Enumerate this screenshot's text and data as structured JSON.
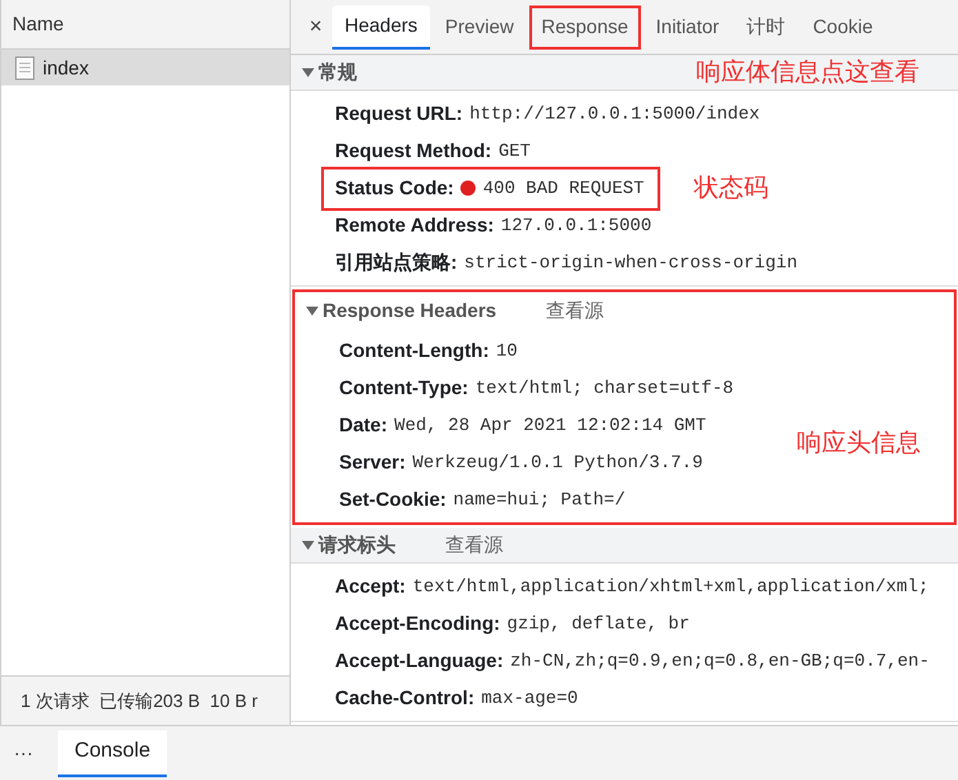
{
  "request_list": {
    "header": "Name",
    "items": [
      {
        "name": "index",
        "selected": true
      }
    ],
    "status_bar": "1 次请求  已传输203 B  10 B r"
  },
  "tabs": {
    "close": "×",
    "items": [
      {
        "label": "Headers",
        "selected": true,
        "highlighted": false
      },
      {
        "label": "Preview",
        "selected": false,
        "highlighted": false
      },
      {
        "label": "Response",
        "selected": false,
        "highlighted": true
      },
      {
        "label": "Initiator",
        "selected": false,
        "highlighted": false
      },
      {
        "label": "计时",
        "selected": false,
        "highlighted": false
      },
      {
        "label": "Cookie",
        "selected": false,
        "highlighted": false
      }
    ]
  },
  "sections": [
    {
      "title": "常规",
      "expanded": true,
      "highlighted": false,
      "note": "响应体信息点这查看",
      "rows": [
        {
          "key": "Request URL:",
          "value": "http://127.0.0.1:5000/index",
          "highlighted": false
        },
        {
          "key": "Request Method:",
          "value": "GET",
          "highlighted": false
        },
        {
          "key": "Status Code:",
          "value": "400 BAD REQUEST",
          "highlighted": true,
          "color": "#e02020",
          "note": "状态码"
        },
        {
          "key": "Remote Address:",
          "value": "127.0.0.1:5000",
          "highlighted": false
        },
        {
          "key": "引用站点策略:",
          "value": "strict-origin-when-cross-origin",
          "highlighted": false
        }
      ]
    },
    {
      "title": "Response Headers",
      "expanded": true,
      "highlighted": true,
      "link": "查看源",
      "note": "响应头信息",
      "rows": [
        {
          "key": "Content-Length:",
          "value": "10",
          "highlighted": false
        },
        {
          "key": "Content-Type:",
          "value": "text/html; charset=utf-8",
          "highlighted": false
        },
        {
          "key": "Date:",
          "value": "Wed, 28 Apr 2021 12:02:14 GMT",
          "highlighted": false
        },
        {
          "key": "Server:",
          "value": "Werkzeug/1.0.1 Python/3.7.9",
          "highlighted": false
        },
        {
          "key": "Set-Cookie:",
          "value": "name=hui; Path=/",
          "highlighted": false
        }
      ]
    },
    {
      "title": "请求标头",
      "expanded": true,
      "highlighted": false,
      "link": "查看源",
      "rows": [
        {
          "key": "Accept:",
          "value": "text/html,application/xhtml+xml,application/xml;",
          "highlighted": false
        },
        {
          "key": "Accept-Encoding:",
          "value": "gzip, deflate, br",
          "highlighted": false
        },
        {
          "key": "Accept-Language:",
          "value": "zh-CN,zh;q=0.9,en;q=0.8,en-GB;q=0.7,en-",
          "highlighted": false
        },
        {
          "key": "Cache-Control:",
          "value": "max-age=0",
          "highlighted": false
        }
      ]
    }
  ],
  "drawer": {
    "more": "···",
    "tabs": [
      {
        "label": "Console",
        "selected": true
      }
    ]
  }
}
